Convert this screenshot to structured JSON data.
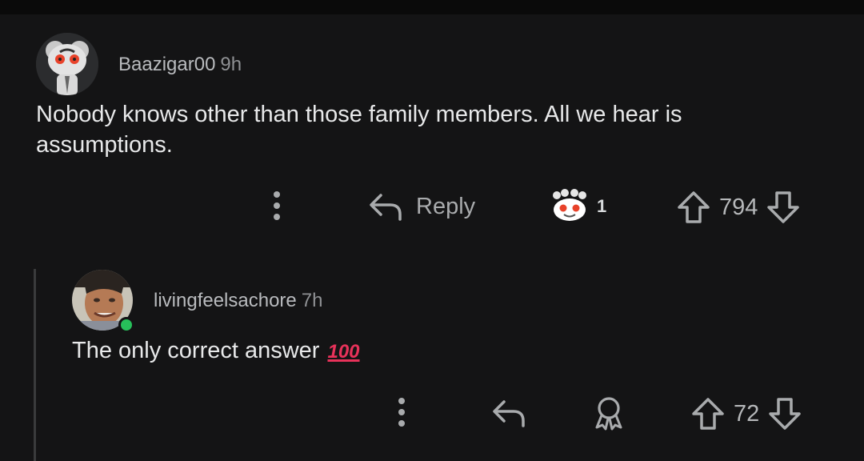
{
  "comments": [
    {
      "username": "Baazigar00",
      "time": "9h",
      "text": "Nobody knows other than those family members. All we hear is assumptions.",
      "reply_label": "Reply",
      "award_count": "1",
      "score": "794"
    },
    {
      "username": "livingfeelsachore",
      "time": "7h",
      "text": "The only correct answer",
      "emoji": "💯",
      "score": "72",
      "online": true
    }
  ],
  "colors": {
    "background": "#141415",
    "online": "#27c05a",
    "hundred": "#e8325a"
  }
}
